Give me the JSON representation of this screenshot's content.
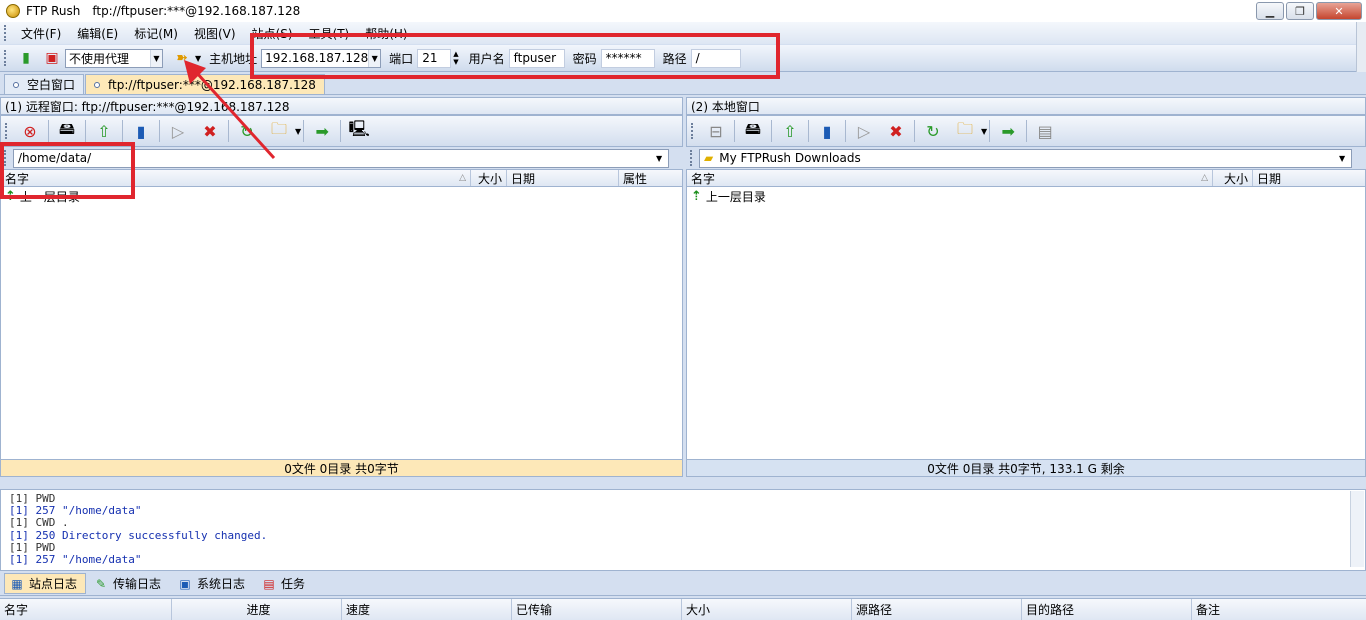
{
  "window": {
    "app_name": "FTP Rush",
    "title_url": "ftp://ftpuser:***@192.168.187.128"
  },
  "menu": [
    "文件(F)",
    "编辑(E)",
    "标记(M)",
    "视图(V)",
    "站点(S)",
    "工具(T)",
    "帮助(H)"
  ],
  "connect": {
    "proxy": "不使用代理",
    "host_label": "主机地址",
    "host": "192.168.187.128",
    "port_label": "端口",
    "port": "21",
    "user_label": "用户名",
    "user": "ftpuser",
    "pass_label": "密码",
    "pass": "******",
    "path_label": "路径",
    "path": "/"
  },
  "tabs": [
    {
      "label": "空白窗口"
    },
    {
      "label": "ftp://ftpuser:***@192.168.187.128"
    }
  ],
  "remote": {
    "title": "(1) 远程窗口: ftp://ftpuser:***@192.168.187.128",
    "path": "/home/data/",
    "columns": [
      "名字",
      "大小",
      "日期",
      "属性"
    ],
    "rows": [
      {
        "name": "上一层目录"
      }
    ],
    "status": "0文件 0目录 共0字节"
  },
  "local": {
    "title": "(2) 本地窗口",
    "path": "My FTPRush Downloads",
    "columns": [
      "名字",
      "大小",
      "日期"
    ],
    "rows": [
      {
        "name": "上一层目录"
      }
    ],
    "status": "0文件 0目录 共0字节, 133.1 G 剩余"
  },
  "log": [
    {
      "type": "cmd",
      "text": "[1] PWD"
    },
    {
      "type": "resp",
      "text": "[1] 257 \"/home/data\""
    },
    {
      "type": "cmd",
      "text": "[1] CWD ."
    },
    {
      "type": "resp",
      "text": "[1] 250 Directory successfully changed."
    },
    {
      "type": "cmd",
      "text": "[1] PWD"
    },
    {
      "type": "resp",
      "text": "[1] 257 \"/home/data\""
    }
  ],
  "log_tabs": [
    "站点日志",
    "传输日志",
    "系统日志",
    "任务"
  ],
  "queue_columns": [
    "名字",
    "进度",
    "速度",
    "已传输",
    "大小",
    "源路径",
    "目的路径",
    "备注"
  ],
  "colors": {
    "highlight": "#e0262e",
    "tab_active": "#fde8b8",
    "remote_status_bg": "#fde8b8",
    "local_status_bg": "#d6e2f2"
  }
}
